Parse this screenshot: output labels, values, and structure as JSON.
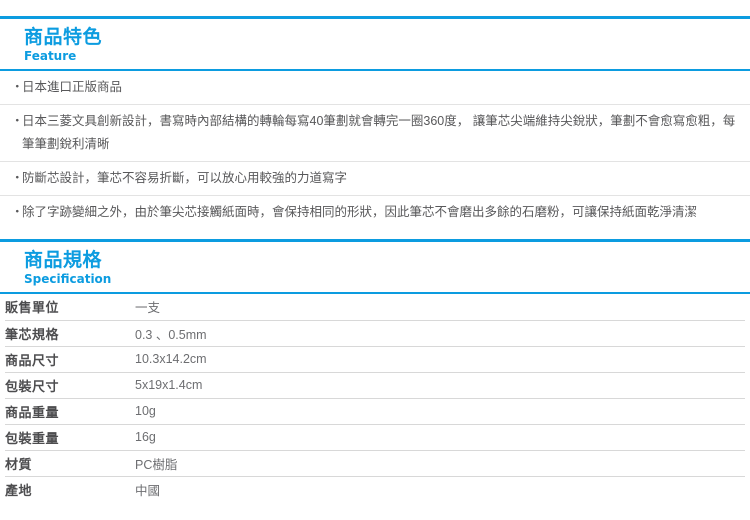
{
  "theme": {
    "accent": "#0c9ce0",
    "text": "#58585a",
    "label_text": "#4d4d4f",
    "rule": "#d8d8d8",
    "background": "#ffffff"
  },
  "feature_section": {
    "title_zh": "商品特色",
    "title_en": "Feature",
    "bullet_glyph": "・",
    "items": [
      "日本進口正版商品",
      "日本三菱文具創新設計，書寫時內部結構的轉輪每寫40筆劃就會轉完一圈360度， 讓筆芯尖端維持尖銳狀，筆劃不會愈寫愈粗，每筆筆劃銳利清晰",
      "防斷芯設計，筆芯不容易折斷，可以放心用較強的力道寫字",
      "除了字跡變細之外，由於筆尖芯接觸紙面時，會保持相同的形狀，因此筆芯不會磨出多餘的石磨粉，可讓保持紙面乾淨清潔"
    ]
  },
  "spec_section": {
    "title_zh": "商品規格",
    "title_en": "Specification",
    "rows": [
      {
        "label": "販售單位",
        "value": "一支"
      },
      {
        "label": "筆芯規格",
        "value": "0.3 、0.5mm"
      },
      {
        "label": "商品尺寸",
        "value": "10.3x14.2cm"
      },
      {
        "label": "包裝尺寸",
        "value": "5x19x1.4cm"
      },
      {
        "label": "商品重量",
        "value": "10g"
      },
      {
        "label": "包裝重量",
        "value": "16g"
      },
      {
        "label": "材質",
        "value": "PC樹脂"
      },
      {
        "label": "產地",
        "value": "中國"
      }
    ]
  }
}
